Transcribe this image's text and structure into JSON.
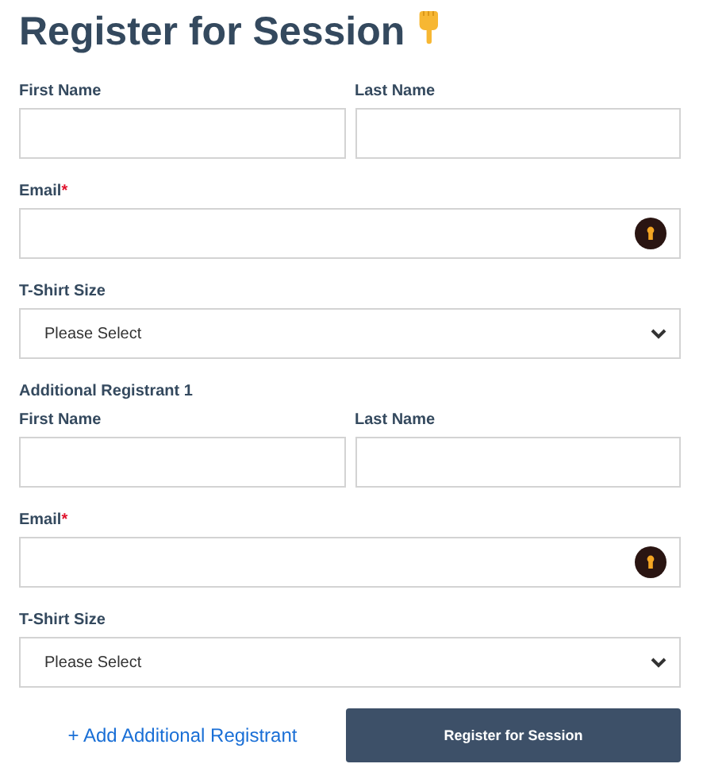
{
  "title": "Register for Session",
  "sections": [
    {
      "first_name": {
        "label": "First Name"
      },
      "last_name": {
        "label": "Last Name"
      },
      "email": {
        "label": "Email",
        "required_mark": "*"
      },
      "tshirt": {
        "label": "T-Shirt Size",
        "value": "Please Select"
      }
    },
    {
      "heading": "Additional Registrant 1",
      "first_name": {
        "label": "First Name"
      },
      "last_name": {
        "label": "Last Name"
      },
      "email": {
        "label": "Email",
        "required_mark": "*"
      },
      "tshirt": {
        "label": "T-Shirt Size",
        "value": "Please Select"
      }
    }
  ],
  "add_link": "+ Add Additional Registrant",
  "submit_button": "Register for Session"
}
